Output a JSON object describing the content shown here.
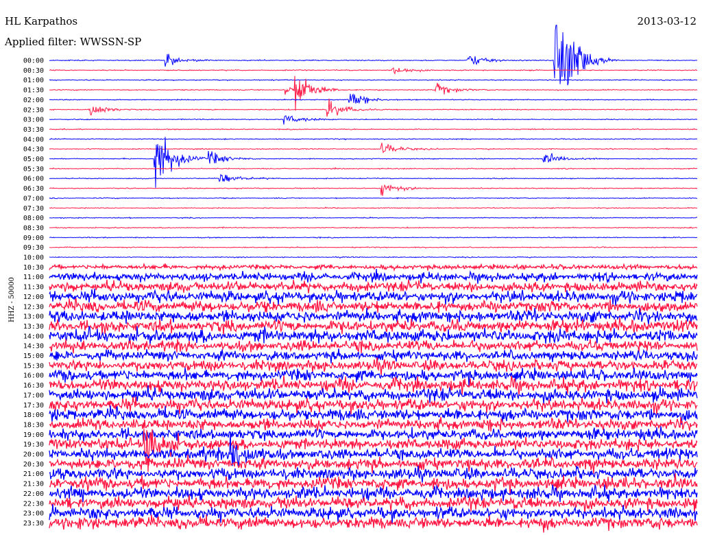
{
  "chart_data": {
    "type": "line",
    "title": "HL Karpathos",
    "date": "2013-03-12",
    "subtitle": "Applied filter: WWSSN-SP",
    "ylabel": "HHZ - 50000",
    "row_labels": [
      "00:00",
      "00:30",
      "01:00",
      "01:30",
      "02:00",
      "02:30",
      "03:00",
      "03:30",
      "04:00",
      "04:30",
      "05:00",
      "05:30",
      "06:00",
      "06:30",
      "07:00",
      "07:30",
      "08:00",
      "08:30",
      "09:00",
      "09:30",
      "10:00",
      "10:30",
      "11:00",
      "11:30",
      "12:00",
      "12:30",
      "13:00",
      "13:30",
      "14:00",
      "14:30",
      "15:00",
      "15:30",
      "16:00",
      "16:30",
      "17:00",
      "17:30",
      "18:00",
      "18:30",
      "19:00",
      "19:30",
      "20:00",
      "20:30",
      "21:00",
      "21:30",
      "22:00",
      "22:30",
      "23:00",
      "23:30"
    ],
    "series_colors": [
      "#0000ff",
      "#ff1744"
    ],
    "noise_levels": [
      0.6,
      0.6,
      0.6,
      0.6,
      0.6,
      0.6,
      0.6,
      0.6,
      0.6,
      0.6,
      0.6,
      0.6,
      0.6,
      0.6,
      0.6,
      0.6,
      0.6,
      0.6,
      0.6,
      0.6,
      0.6,
      3.0,
      5.0,
      6.0,
      7.0,
      7.0,
      7.5,
      7.5,
      8.0,
      6.5,
      6.0,
      6.5,
      7.0,
      7.5,
      7.5,
      7.5,
      7.5,
      7.0,
      7.0,
      7.0,
      7.0,
      7.0,
      7.0,
      7.5,
      7.5,
      7.5,
      7.5,
      7.5
    ],
    "events": [
      {
        "time": "00:00",
        "minute": 5.5,
        "amp": 1.0
      },
      {
        "time": "00:00",
        "minute": 19.5,
        "amp": 1.0
      },
      {
        "time": "00:00",
        "minute": 23.5,
        "amp": 8.0
      },
      {
        "time": "00:00",
        "minute": 24.0,
        "amp": 2.5
      },
      {
        "time": "00:30",
        "minute": 16.0,
        "amp": 0.8
      },
      {
        "time": "01:30",
        "minute": 11.0,
        "amp": 0.8
      },
      {
        "time": "01:30",
        "minute": 11.5,
        "amp": 3.0
      },
      {
        "time": "01:30",
        "minute": 18.0,
        "amp": 1.0
      },
      {
        "time": "02:00",
        "minute": 14.0,
        "amp": 1.2
      },
      {
        "time": "02:30",
        "minute": 2.0,
        "amp": 1.0
      },
      {
        "time": "02:30",
        "minute": 13.0,
        "amp": 1.5
      },
      {
        "time": "03:00",
        "minute": 11.0,
        "amp": 0.8
      },
      {
        "time": "04:30",
        "minute": 15.5,
        "amp": 1.0
      },
      {
        "time": "05:00",
        "minute": 5.0,
        "amp": 6.0
      },
      {
        "time": "05:00",
        "minute": 7.5,
        "amp": 1.2
      },
      {
        "time": "05:00",
        "minute": 23.0,
        "amp": 1.0
      },
      {
        "time": "06:00",
        "minute": 8.0,
        "amp": 1.0
      },
      {
        "time": "06:30",
        "minute": 15.5,
        "amp": 1.2
      },
      {
        "time": "19:30",
        "minute": 4.5,
        "amp": 4.0
      },
      {
        "time": "20:00",
        "minute": 8.5,
        "amp": 3.0
      }
    ]
  }
}
